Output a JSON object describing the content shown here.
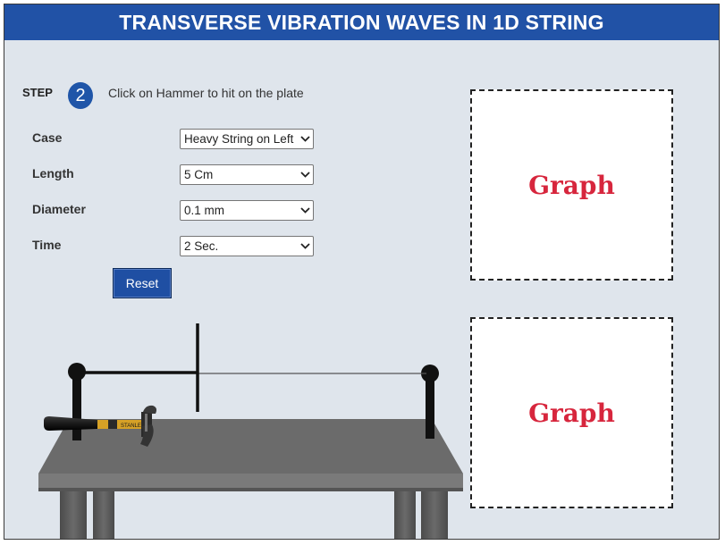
{
  "header": {
    "title": "TRANSVERSE VIBRATION WAVES IN 1D STRING"
  },
  "step": {
    "label": "STEP",
    "number": "2",
    "instruction": "Click on Hammer to hit on the plate"
  },
  "controls": {
    "case": {
      "label": "Case",
      "value": "Heavy String on Left"
    },
    "length": {
      "label": "Length",
      "value": "5 Cm"
    },
    "diameter": {
      "label": "Diameter",
      "value": "0.1 mm"
    },
    "time": {
      "label": "Time",
      "value": "2 Sec."
    },
    "reset_label": "Reset"
  },
  "graphs": [
    {
      "label": "Graph"
    },
    {
      "label": "Graph"
    }
  ],
  "colors": {
    "header_bg": "#2152a6",
    "panel_bg": "#dfe5ec",
    "graph_text": "#d7263d",
    "button_bg": "#1f4fa3"
  },
  "icons": {
    "select_arrow": "chevron-down-icon",
    "hammer": "hammer-icon"
  }
}
